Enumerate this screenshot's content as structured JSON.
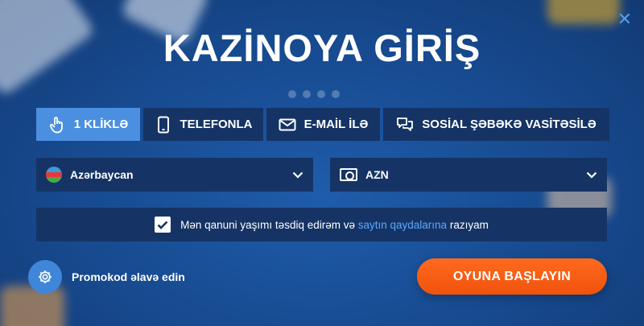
{
  "modal": {
    "title": "KAZİNOYA GİRİŞ",
    "close_icon": "close-icon"
  },
  "tabs": [
    {
      "label": "1 KLİKLƏ",
      "icon": "hand-pointer-icon",
      "active": true
    },
    {
      "label": "TELEFONLA",
      "icon": "phone-icon",
      "active": false
    },
    {
      "label": "E-MAİL İLƏ",
      "icon": "envelope-icon",
      "active": false
    },
    {
      "label": "SOSİAL ŞƏBƏKƏ VASİTƏSİLƏ",
      "icon": "chat-icon",
      "active": false
    }
  ],
  "country_select": {
    "value": "Azərbaycan",
    "icon": "azerbaijan-flag-icon"
  },
  "currency_select": {
    "value": "AZN",
    "icon": "money-icon"
  },
  "agreement": {
    "checked": true,
    "text_before": "Mən qanuni yaşımı təsdiq edirəm və",
    "link": "saytın qaydalarına",
    "text_after": "razıyam"
  },
  "promo": {
    "label": "Promokod əlavə edin",
    "icon": "gear-icon"
  },
  "start_button": {
    "label": "OYUNA BAŞLAYIN"
  },
  "colors": {
    "panel": "#153465",
    "active_tab": "#4b8fe0",
    "accent_orange": "#f0520c",
    "link": "#5aa8ff"
  }
}
